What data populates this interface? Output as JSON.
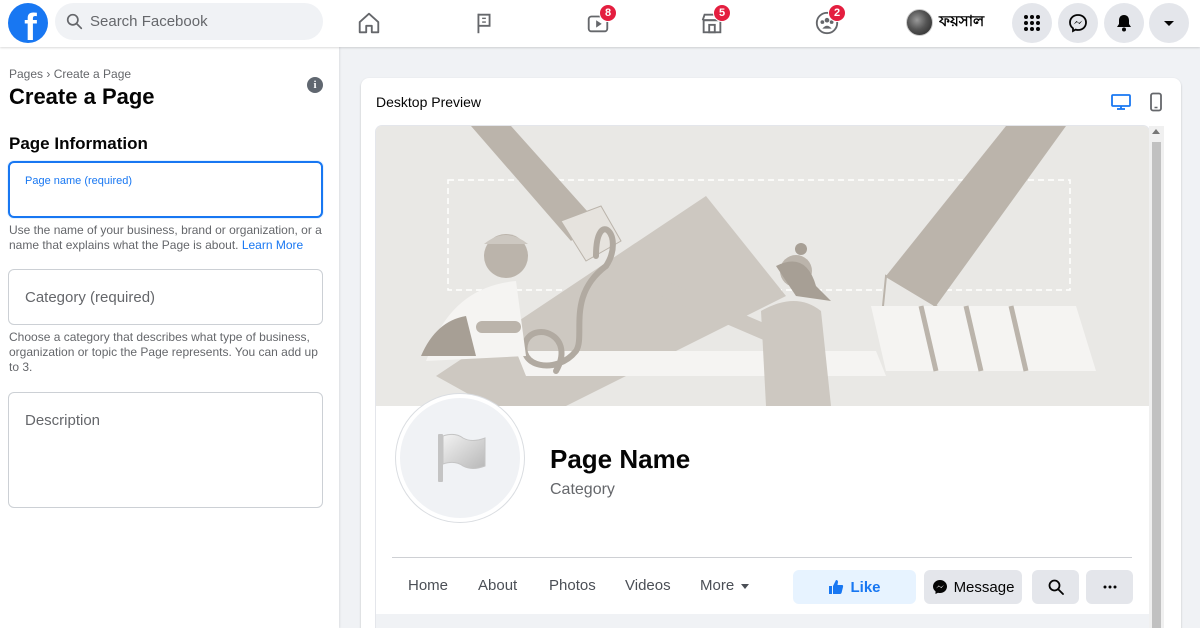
{
  "topbar": {
    "logo_letter": "f",
    "search_placeholder": "Search Facebook",
    "badges": {
      "watch": "8",
      "marketplace": "5",
      "groups": "2"
    },
    "profile_name": "ফয়সাল"
  },
  "left": {
    "breadcrumb": "Pages › Create a Page",
    "title": "Create a Page",
    "info_glyph": "i",
    "section_title": "Page Information",
    "page_name_label": "Page name (required)",
    "page_name_help": "Use the name of your business, brand or organization, or a name that explains what the Page is about.",
    "learn_more": "Learn More",
    "category_placeholder": "Category (required)",
    "category_help": "Choose a category that describes what type of business, organization or topic the Page represents. You can add up to 3.",
    "description_placeholder": "Description"
  },
  "preview": {
    "title": "Desktop Preview",
    "page_name": "Page Name",
    "category": "Category",
    "tabs": [
      "Home",
      "About",
      "Photos",
      "Videos",
      "More"
    ],
    "like_label": "Like",
    "message_label": "Message"
  },
  "colors": {
    "brand": "#1877f2",
    "badge": "#e41e3f",
    "cover_bg": "#e9e8e5"
  }
}
